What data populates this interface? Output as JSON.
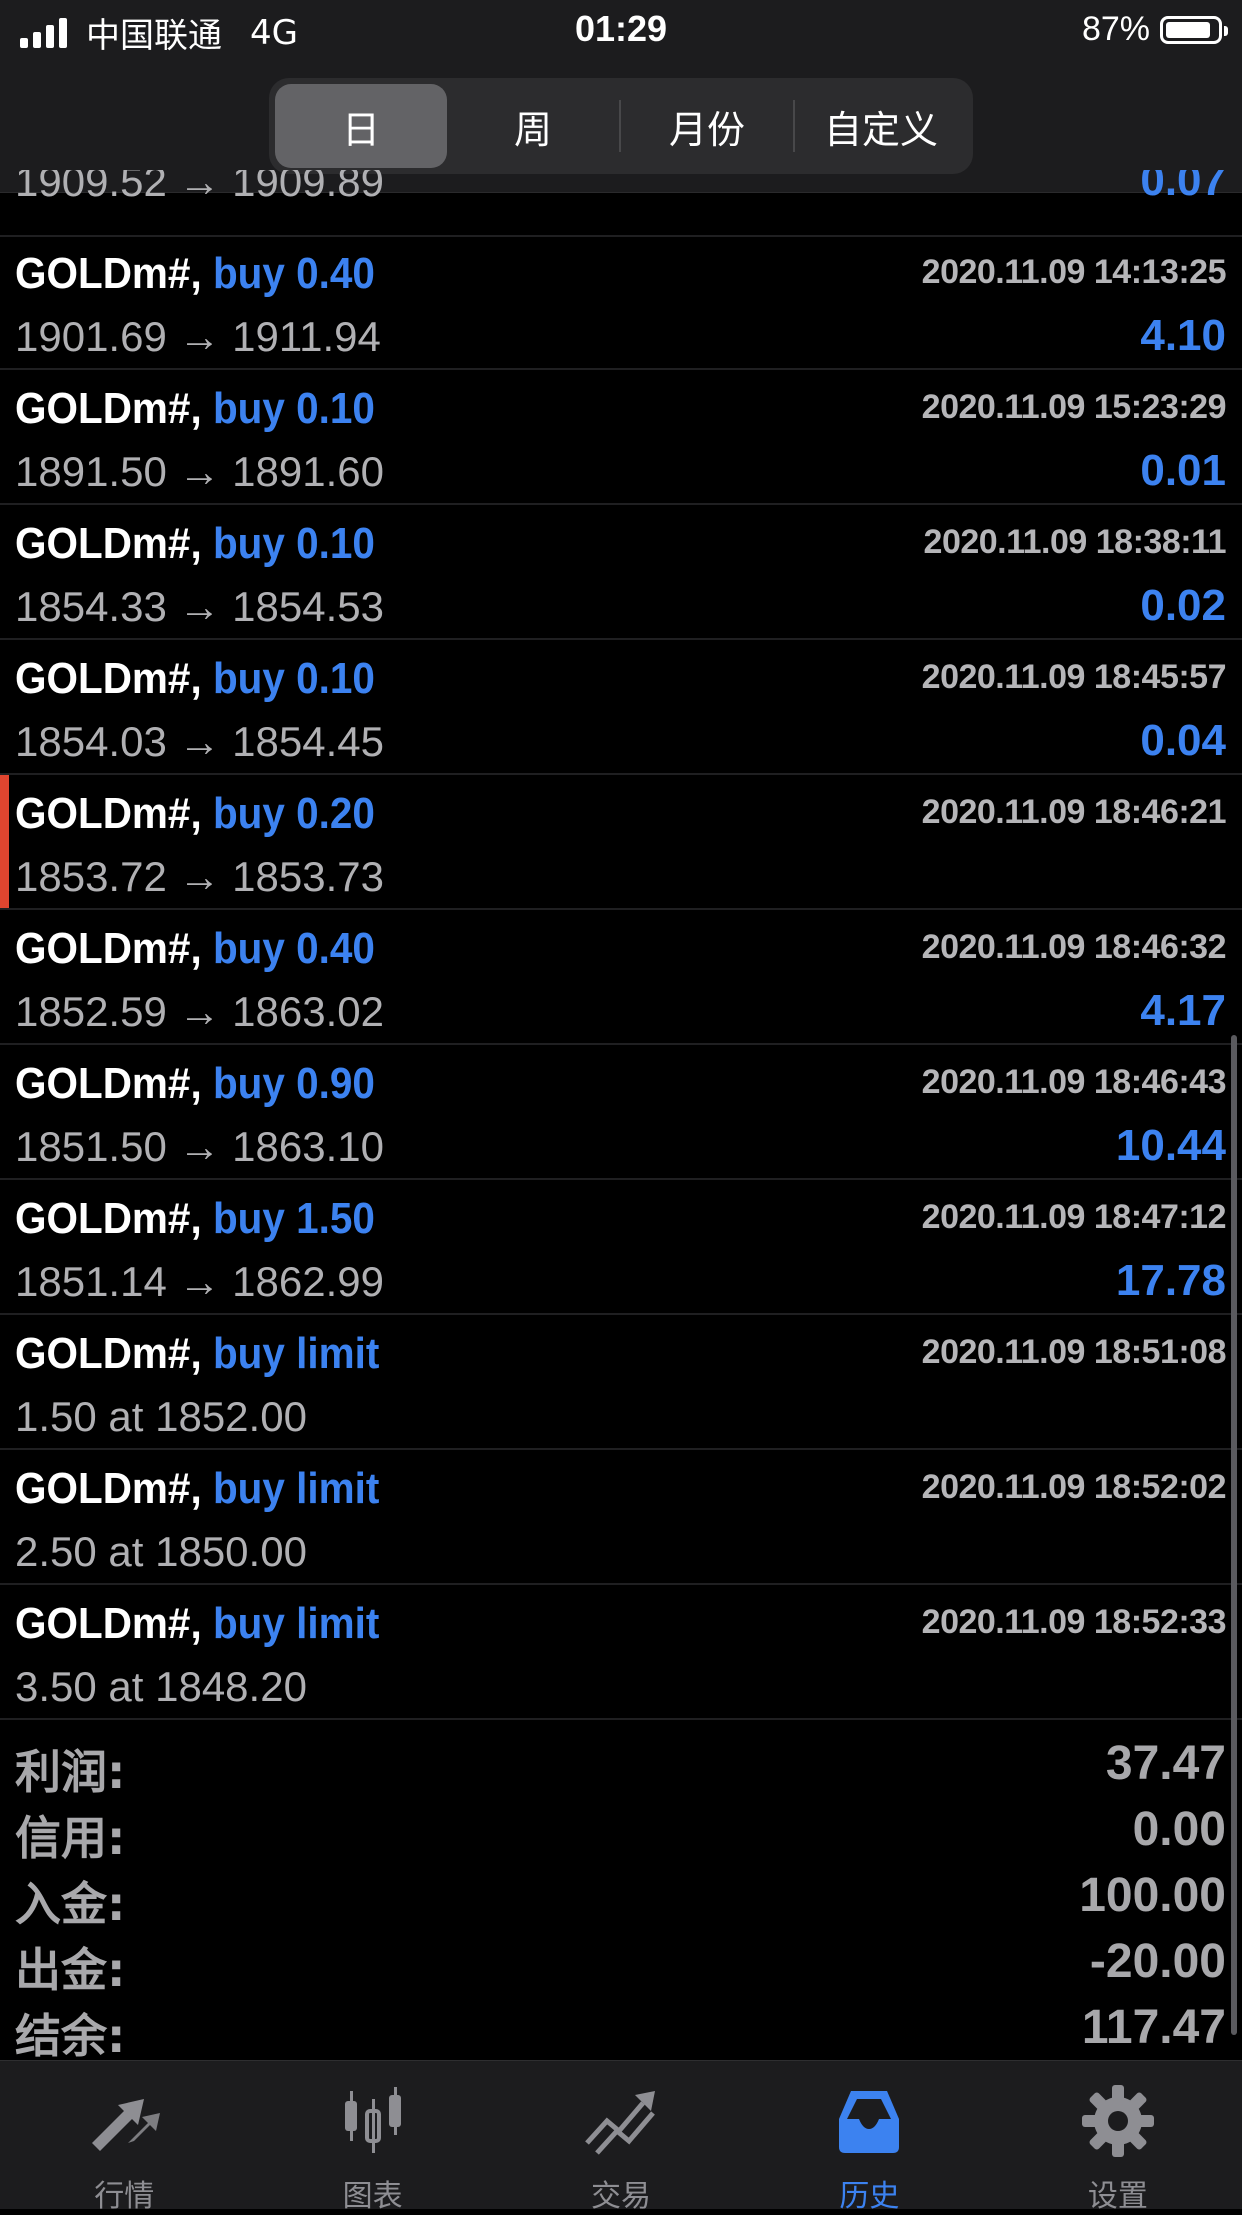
{
  "status_bar": {
    "carrier": "中国联通",
    "network": "4G",
    "time": "01:29",
    "battery": "87%",
    "battery_level": 0.87
  },
  "period_tabs": [
    {
      "label": "日",
      "active": true
    },
    {
      "label": "周",
      "active": false
    },
    {
      "label": "月份",
      "active": false
    },
    {
      "label": "自定义",
      "active": false
    }
  ],
  "partial_row": {
    "prices": "1909.52 → 1909.89",
    "profit": "0.07"
  },
  "trades": [
    {
      "symbol": "GOLDm#,",
      "action": "buy 0.40",
      "time": "2020.11.09 14:13:25",
      "prices": "1901.69 → 1911.94",
      "profit": "4.10",
      "marked": false
    },
    {
      "symbol": "GOLDm#,",
      "action": "buy 0.10",
      "time": "2020.11.09 15:23:29",
      "prices": "1891.50 → 1891.60",
      "profit": "0.01",
      "marked": false
    },
    {
      "symbol": "GOLDm#,",
      "action": "buy 0.10",
      "time": "2020.11.09 18:38:11",
      "prices": "1854.33 → 1854.53",
      "profit": "0.02",
      "marked": false
    },
    {
      "symbol": "GOLDm#,",
      "action": "buy 0.10",
      "time": "2020.11.09 18:45:57",
      "prices": "1854.03 → 1854.45",
      "profit": "0.04",
      "marked": false
    },
    {
      "symbol": "GOLDm#,",
      "action": "buy 0.20",
      "time": "2020.11.09 18:46:21",
      "prices": "1853.72 → 1853.73",
      "profit": "",
      "marked": true
    },
    {
      "symbol": "GOLDm#,",
      "action": "buy 0.40",
      "time": "2020.11.09 18:46:32",
      "prices": "1852.59 → 1863.02",
      "profit": "4.17",
      "marked": false
    },
    {
      "symbol": "GOLDm#,",
      "action": "buy 0.90",
      "time": "2020.11.09 18:46:43",
      "prices": "1851.50 → 1863.10",
      "profit": "10.44",
      "marked": false
    },
    {
      "symbol": "GOLDm#,",
      "action": "buy 1.50",
      "time": "2020.11.09 18:47:12",
      "prices": "1851.14 → 1862.99",
      "profit": "17.78",
      "marked": false
    },
    {
      "symbol": "GOLDm#,",
      "action": "buy limit",
      "time": "2020.11.09 18:51:08",
      "prices": "1.50 at 1852.00",
      "profit": "",
      "marked": false
    },
    {
      "symbol": "GOLDm#,",
      "action": "buy limit",
      "time": "2020.11.09 18:52:02",
      "prices": "2.50 at 1850.00",
      "profit": "",
      "marked": false
    },
    {
      "symbol": "GOLDm#,",
      "action": "buy limit",
      "time": "2020.11.09 18:52:33",
      "prices": "3.50 at 1848.20",
      "profit": "",
      "marked": false
    }
  ],
  "summary": [
    {
      "label": "利润:",
      "value": "37.47"
    },
    {
      "label": "信用:",
      "value": "0.00"
    },
    {
      "label": "入金:",
      "value": "100.00"
    },
    {
      "label": "出金:",
      "value": "-20.00"
    },
    {
      "label": "结余:",
      "value": "117.47"
    }
  ],
  "tabbar": [
    {
      "label": "行情",
      "icon": "quotes-arrows-icon",
      "active": false
    },
    {
      "label": "图表",
      "icon": "candlestick-chart-icon",
      "active": false
    },
    {
      "label": "交易",
      "icon": "trade-trend-icon",
      "active": false
    },
    {
      "label": "历史",
      "icon": "history-inbox-icon",
      "active": true
    },
    {
      "label": "设置",
      "icon": "gear-icon",
      "active": false
    }
  ],
  "colors": {
    "accent": "#3c82f0",
    "marker": "#e0452f",
    "background": "#000000",
    "bar": "#1c1c1e"
  }
}
